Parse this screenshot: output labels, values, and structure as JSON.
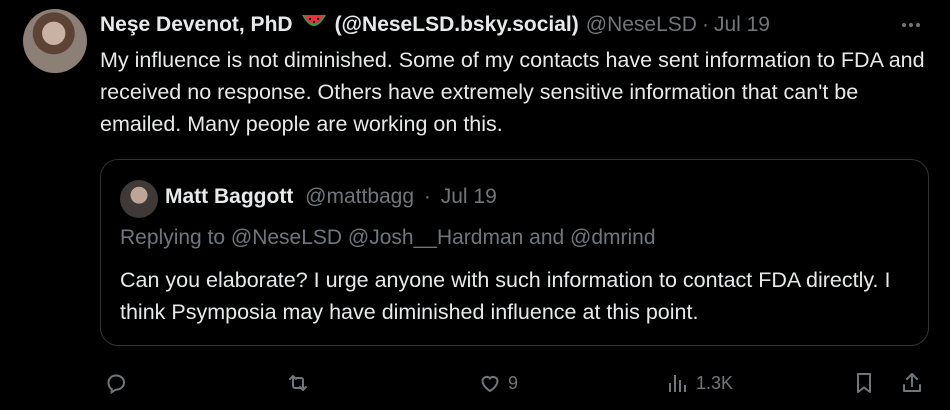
{
  "tweet": {
    "author_name": "Neşe Devenot, PhD",
    "author_emoji": "watermelon-emoji",
    "author_bsky": "(@NeseLSD.bsky.social)",
    "handle": "@NeseLSD",
    "separator": "·",
    "date": "Jul 19",
    "text": "My influence is not diminished. Some of my contacts have sent information to FDA and received no response. Others have extremely sensitive information that can't be emailed. Many people are working on this."
  },
  "quoted": {
    "author_name": "Matt Baggott",
    "handle": "@mattbagg",
    "separator": "·",
    "date": "Jul 19",
    "replying_to": "Replying to @NeseLSD @Josh__Hardman and @dmrind",
    "text": "Can you elaborate? I urge anyone with such information to contact FDA directly. I think Psymposia may have diminished influence at this point."
  },
  "actions": {
    "reply_icon": "reply-icon",
    "retweet_icon": "retweet-icon",
    "like_icon": "heart-icon",
    "like_count": "9",
    "views_icon": "views-icon",
    "views_count": "1.3K",
    "bookmark_icon": "bookmark-icon",
    "share_icon": "share-icon"
  },
  "colors": {
    "background": "#000000",
    "text": "#e7e9ea",
    "muted": "#71767b",
    "border": "#2f3336"
  }
}
